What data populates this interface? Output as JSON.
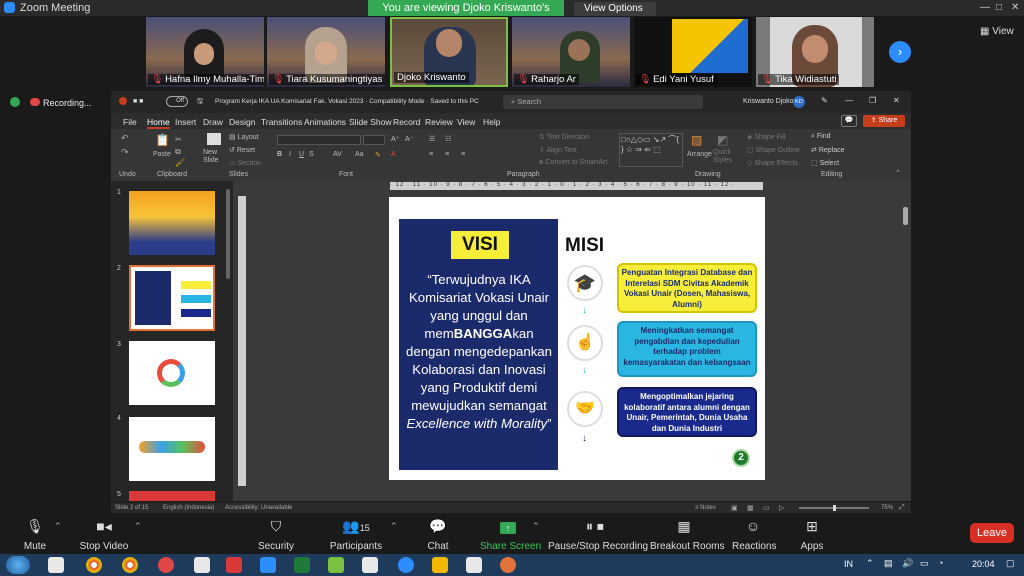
{
  "zoom": {
    "title": "Zoom Meeting",
    "banner": "You are viewing Djoko Kriswanto's screen",
    "view_options": "View Options",
    "view_button": "View",
    "participants": [
      {
        "name": "Hafna Ilmy Muhalla-Tim ..."
      },
      {
        "name": "Tiara Kusumaningtiyas"
      },
      {
        "name": "Djoko Kriswanto"
      },
      {
        "name": "Raharjo Ar"
      },
      {
        "name": "Edi Yani Yusuf"
      },
      {
        "name": "Tika Widiastuti"
      }
    ],
    "recording_label": "Recording...",
    "toolbar": {
      "mute": "Mute",
      "stop_video": "Stop Video",
      "security": "Security",
      "participants": "Participants",
      "participants_count": "15",
      "chat": "Chat",
      "share_screen": "Share Screen",
      "pause_recording": "Pause/Stop Recording",
      "breakout_rooms": "Breakout Rooms",
      "reactions": "Reactions",
      "apps": "Apps",
      "leave": "Leave"
    }
  },
  "ppt": {
    "toggle": "Off",
    "doc_title": "Program Kerja IKA UA Komisariat Fak. Vokasi 2023  ·  Compatibility Mode  ·  Saved to this PC",
    "search_placeholder": "Search",
    "user": "Kriswanto Djoko",
    "user_initials": "KD",
    "share": "Share",
    "menu": [
      "File",
      "Home",
      "Insert",
      "Draw",
      "Design",
      "Transitions",
      "Animations",
      "Slide Show",
      "Record",
      "Review",
      "View",
      "Help"
    ],
    "ribbon_groups": [
      "Undo",
      "Clipboard",
      "Slides",
      "Font",
      "Paragraph",
      "Drawing",
      "Editing"
    ],
    "ribbon": {
      "paste": "Paste",
      "new_slide": "New Slide",
      "layout": "Layout",
      "reset": "Reset",
      "section": "Section",
      "text_direction": "Text Direction",
      "align_text": "Align Text",
      "convert_smartart": "Convert to SmartArt",
      "arrange": "Arrange",
      "quick_styles": "Quick Styles",
      "shape_fill": "Shape Fill",
      "shape_outline": "Shape Outline",
      "shape_effects": "Shape Effects",
      "find": "Find",
      "replace": "Replace",
      "select": "Select"
    },
    "ruler": "· 12 · 11 · 10 · 9 · 8 · 7 · 6 · 5 · 4 · 3 · 2 · 1 · 0 · 1 · 2 · 3 · 4 · 5 · 6 · 7 · 8 · 9 · 10 · 11 · 12 ·",
    "thumb_numbers": [
      "1",
      "2",
      "3",
      "4",
      "5"
    ],
    "status": {
      "slide": "Slide 2 of 15",
      "language": "English (Indonesia)",
      "accessibility": "Accessibility: Unavailable",
      "notes": "Notes",
      "zoom": "75%"
    }
  },
  "slide": {
    "visi_title": "VISI",
    "misi_title": "MISI",
    "visi_text_1": "“Terwujudnya IKA Komisariat Vokasi Unair yang unggul dan mem",
    "visi_bold": "BANGGA",
    "visi_text_2": "kan dengan mengedepankan Kolaborasi dan Inovasi yang Produktif demi mewujudkan semangat ",
    "visi_italic": "Excellence with Morality",
    "visi_end": "”",
    "misi": [
      {
        "text": "Penguatan Integrasi Database dan Interelasi SDM Civitas Akademik Vokasi  Unair (Dosen, Mahasiswa, Alumni)"
      },
      {
        "text": "Meningkatkan semangat pengabdian dan kepedulian terhadap problem kemasyarakatan dan kebangsaan"
      },
      {
        "text": "Mengoptimalkan jejaring kolaboratif antara alumni dengan Unair, Pemerintah, Dunia Usaha dan Dunia Industri"
      }
    ],
    "page_number": "2"
  },
  "taskbar": {
    "lang": "IN",
    "time": "20:04"
  },
  "colors": {
    "visi_bg": "#1b2a6b",
    "misi1_bg": "#f7ee3a",
    "misi2_bg": "#29b6e0",
    "misi3_bg": "#1a2a8c",
    "zoom_green": "#34a853",
    "leave_red": "#d93025"
  }
}
